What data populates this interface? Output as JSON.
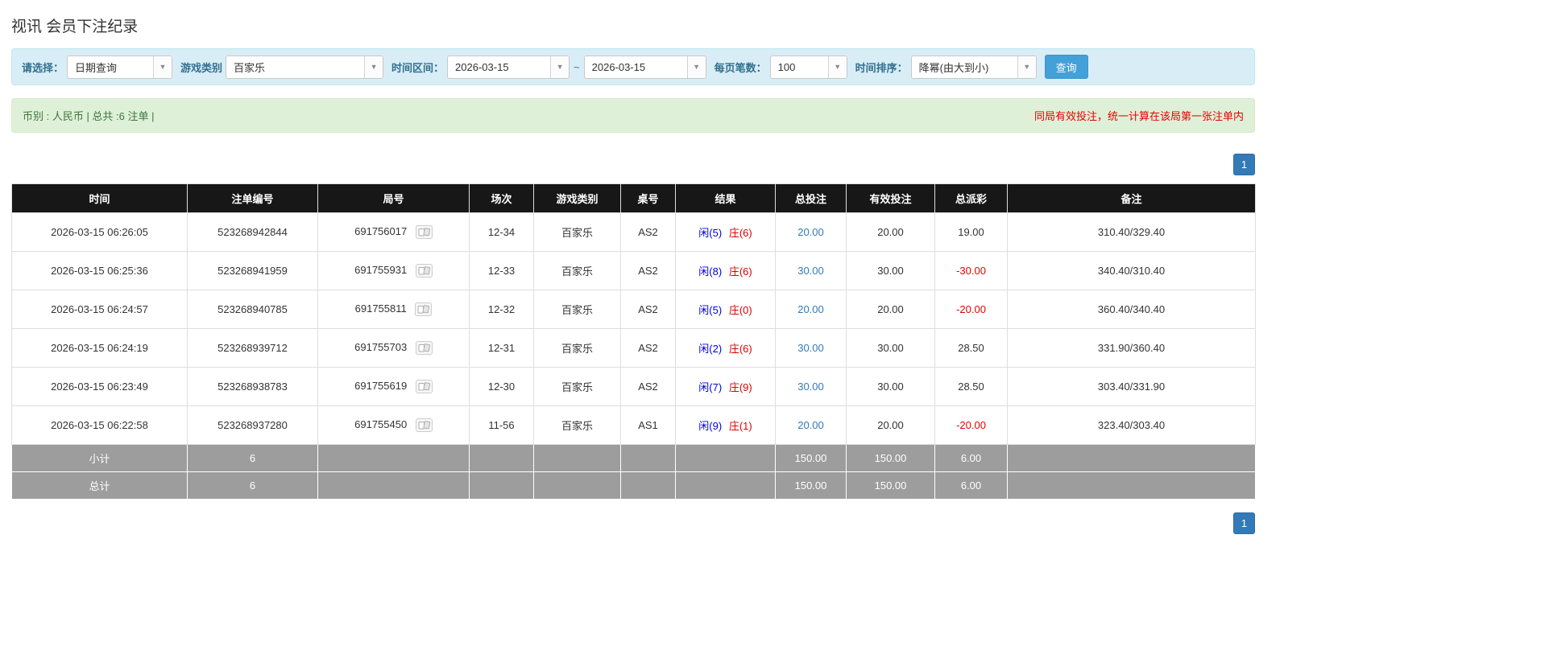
{
  "page": {
    "title": "视讯 会员下注纪录"
  },
  "colors": {
    "accent_blue": "#337ab7",
    "player_blue": "#0000dd",
    "banker_red": "#dd0000",
    "negative_red": "#e60000",
    "table_header_bg": "#171717",
    "filter_bar_bg": "#d9edf7",
    "summary_bar_bg": "#dff0d8",
    "footer_row_bg": "#9d9d9d"
  },
  "filter_bar": {
    "select_label": "请选择：",
    "select_value": "日期查询",
    "game_type_label": "游戏类别",
    "game_type_value": "百家乐",
    "time_range_label": "时间区间：",
    "time_from": "2026-03-15",
    "range_separator": "~",
    "time_to": "2026-03-15",
    "page_size_label": "每页笔数：",
    "page_size_value": "100",
    "sort_label": "时间排序：",
    "sort_value": "降幂(由大到小)",
    "search_button_label": "查询"
  },
  "summary_bar": {
    "left_text": "币别 : 人民币 | 总共 :6 注单 |",
    "right_text": "同局有效投注，统一计算在该局第一张注单内"
  },
  "pagination": {
    "current_page": "1"
  },
  "table": {
    "headers": [
      "时间",
      "注单编号",
      "局号",
      "场次",
      "游戏类别",
      "桌号",
      "结果",
      "总投注",
      "有效投注",
      "总派彩",
      "备注"
    ],
    "rows": [
      {
        "time": "2026-03-15 06:26:05",
        "bet_no": "523268942844",
        "round_no": "691756017",
        "session": "12-34",
        "game": "百家乐",
        "table_no": "AS2",
        "result_player": "闲(5)",
        "result_banker": "庄(6)",
        "total_bet": "20.00",
        "valid_bet": "20.00",
        "payout": "19.00",
        "payout_negative": false,
        "note": "310.40/329.40"
      },
      {
        "time": "2026-03-15 06:25:36",
        "bet_no": "523268941959",
        "round_no": "691755931",
        "session": "12-33",
        "game": "百家乐",
        "table_no": "AS2",
        "result_player": "闲(8)",
        "result_banker": "庄(6)",
        "total_bet": "30.00",
        "valid_bet": "30.00",
        "payout": "-30.00",
        "payout_negative": true,
        "note": "340.40/310.40"
      },
      {
        "time": "2026-03-15 06:24:57",
        "bet_no": "523268940785",
        "round_no": "691755811",
        "session": "12-32",
        "game": "百家乐",
        "table_no": "AS2",
        "result_player": "闲(5)",
        "result_banker": "庄(0)",
        "total_bet": "20.00",
        "valid_bet": "20.00",
        "payout": "-20.00",
        "payout_negative": true,
        "note": "360.40/340.40"
      },
      {
        "time": "2026-03-15 06:24:19",
        "bet_no": "523268939712",
        "round_no": "691755703",
        "session": "12-31",
        "game": "百家乐",
        "table_no": "AS2",
        "result_player": "闲(2)",
        "result_banker": "庄(6)",
        "total_bet": "30.00",
        "valid_bet": "30.00",
        "payout": "28.50",
        "payout_negative": false,
        "note": "331.90/360.40"
      },
      {
        "time": "2026-03-15 06:23:49",
        "bet_no": "523268938783",
        "round_no": "691755619",
        "session": "12-30",
        "game": "百家乐",
        "table_no": "AS2",
        "result_player": "闲(7)",
        "result_banker": "庄(9)",
        "total_bet": "30.00",
        "valid_bet": "30.00",
        "payout": "28.50",
        "payout_negative": false,
        "note": "303.40/331.90"
      },
      {
        "time": "2026-03-15 06:22:58",
        "bet_no": "523268937280",
        "round_no": "691755450",
        "session": "11-56",
        "game": "百家乐",
        "table_no": "AS1",
        "result_player": "闲(9)",
        "result_banker": "庄(1)",
        "total_bet": "20.00",
        "valid_bet": "20.00",
        "payout": "-20.00",
        "payout_negative": true,
        "note": "323.40/303.40"
      }
    ],
    "subtotal": {
      "label": "小计",
      "count": "6",
      "total_bet": "150.00",
      "valid_bet": "150.00",
      "payout": "6.00"
    },
    "total": {
      "label": "总计",
      "count": "6",
      "total_bet": "150.00",
      "valid_bet": "150.00",
      "payout": "6.00"
    }
  }
}
